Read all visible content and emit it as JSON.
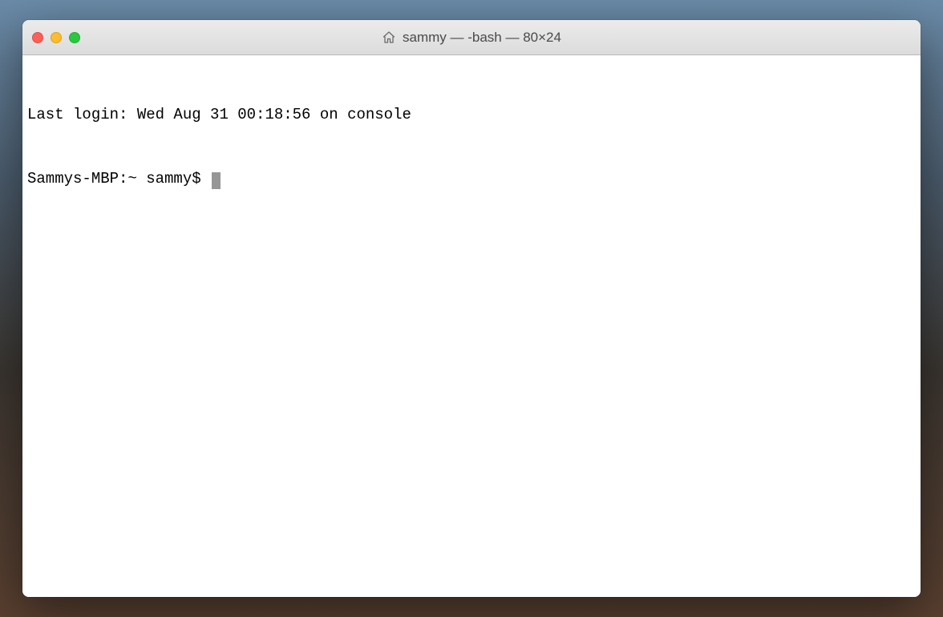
{
  "window": {
    "title": "sammy — -bash — 80×24"
  },
  "terminal": {
    "last_login_line": "Last login: Wed Aug 31 00:18:56 on console",
    "prompt": "Sammys-MBP:~ sammy$ "
  }
}
